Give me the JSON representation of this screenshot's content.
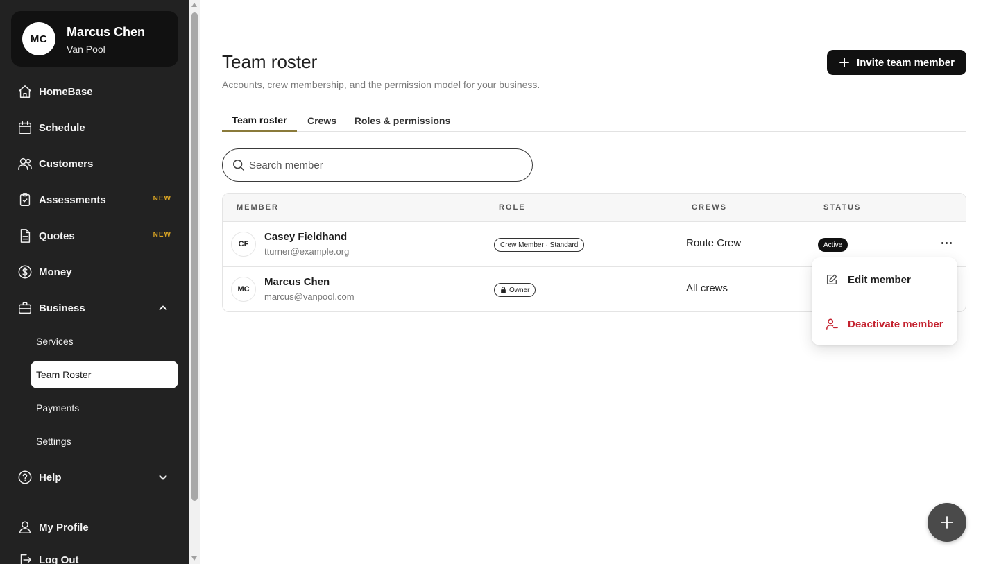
{
  "profile": {
    "initials": "MC",
    "name": "Marcus Chen",
    "org": "Van Pool"
  },
  "nav": {
    "homebase": "HomeBase",
    "schedule": "Schedule",
    "customers": "Customers",
    "assessments": "Assessments",
    "assessments_badge": "NEW",
    "quotes": "Quotes",
    "quotes_badge": "NEW",
    "money": "Money",
    "business": "Business",
    "business_sub": [
      "Services",
      "Team Roster",
      "Payments",
      "Settings"
    ],
    "help": "Help",
    "my_profile": "My Profile",
    "log_out": "Log Out"
  },
  "header": {
    "title": "Team roster",
    "subtitle": "Accounts, crew membership, and the permission model for your business.",
    "invite_label": "Invite team member"
  },
  "tabs": [
    "Team roster",
    "Crews",
    "Roles & permissions"
  ],
  "active_tab": "Team roster",
  "search": {
    "placeholder": "Search member",
    "value": ""
  },
  "table": {
    "columns": [
      "MEMBER",
      "ROLE",
      "CREWS",
      "STATUS"
    ],
    "rows": [
      {
        "initials": "CF",
        "name": "Casey Fieldhand",
        "email": "tturner@example.org",
        "role": "Crew Member · Standard",
        "crews": "Route Crew",
        "status": "Active"
      },
      {
        "initials": "MC",
        "name": "Marcus Chen",
        "email": "marcus@vanpool.com",
        "role": "Owner",
        "crews": "All crews",
        "status": ""
      }
    ]
  },
  "row_menu": {
    "edit": "Edit member",
    "deactivate": "Deactivate member"
  },
  "colors": {
    "sidebar_bg": "#222222",
    "accent_badge": "#d9a424",
    "danger": "#c4222f",
    "tab_underline": "#8a7a3a"
  }
}
